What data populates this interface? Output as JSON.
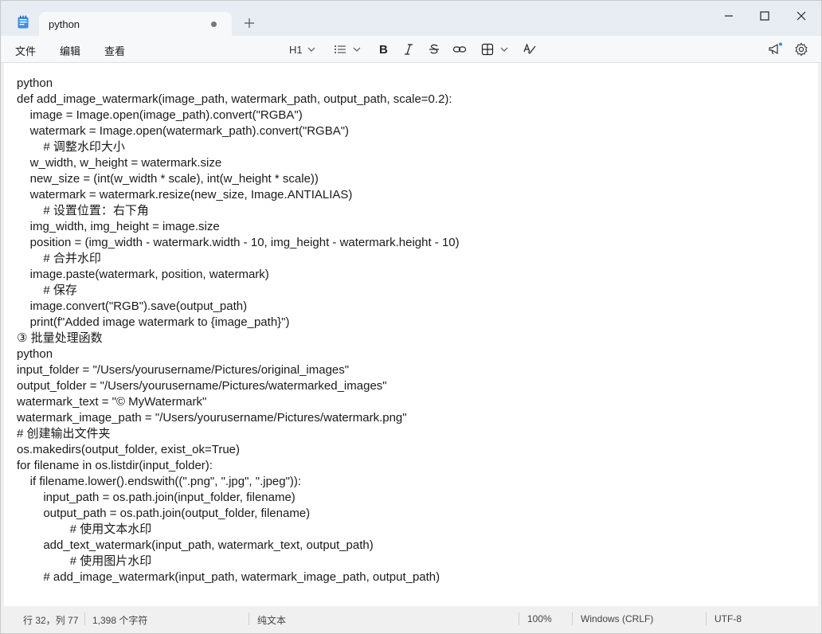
{
  "tab": {
    "title": "python"
  },
  "menu": {
    "file": "文件",
    "edit": "编辑",
    "view": "查看"
  },
  "toolbar": {
    "heading": "H1"
  },
  "editor": {
    "lines": [
      "python",
      "def add_image_watermark(image_path, watermark_path, output_path, scale=0.2):",
      "    image = Image.open(image_path).convert(\"RGBA\")",
      "    watermark = Image.open(watermark_path).convert(\"RGBA\")",
      "        # 调整水印大小",
      "    w_width, w_height = watermark.size",
      "    new_size = (int(w_width * scale), int(w_height * scale))",
      "    watermark = watermark.resize(new_size, Image.ANTIALIAS)",
      "        # 设置位置：右下角",
      "    img_width, img_height = image.size",
      "    position = (img_width - watermark.width - 10, img_height - watermark.height - 10)",
      "        # 合并水印",
      "    image.paste(watermark, position, watermark)",
      "        # 保存",
      "    image.convert(\"RGB\").save(output_path)",
      "    print(f\"Added image watermark to {image_path}\")",
      "③ 批量处理函数",
      "python",
      "input_folder = \"/Users/yourusername/Pictures/original_images\"",
      "output_folder = \"/Users/yourusername/Pictures/watermarked_images\"",
      "watermark_text = \"© MyWatermark\"",
      "watermark_image_path = \"/Users/yourusername/Pictures/watermark.png\"",
      "# 创建输出文件夹",
      "os.makedirs(output_folder, exist_ok=True)",
      "for filename in os.listdir(input_folder):",
      "    if filename.lower().endswith((\".png\", \".jpg\", \".jpeg\")):",
      "        input_path = os.path.join(input_folder, filename)",
      "        output_path = os.path.join(output_folder, filename)",
      "                # 使用文本水印",
      "        add_text_watermark(input_path, watermark_text, output_path)",
      "                # 使用图片水印",
      "        # add_image_watermark(input_path, watermark_image_path, output_path)"
    ]
  },
  "status": {
    "position": "行 32，列 77",
    "chars": "1,398 个字符",
    "format": "纯文本",
    "zoom": "100%",
    "line_ending": "Windows (CRLF)",
    "encoding": "UTF-8"
  }
}
